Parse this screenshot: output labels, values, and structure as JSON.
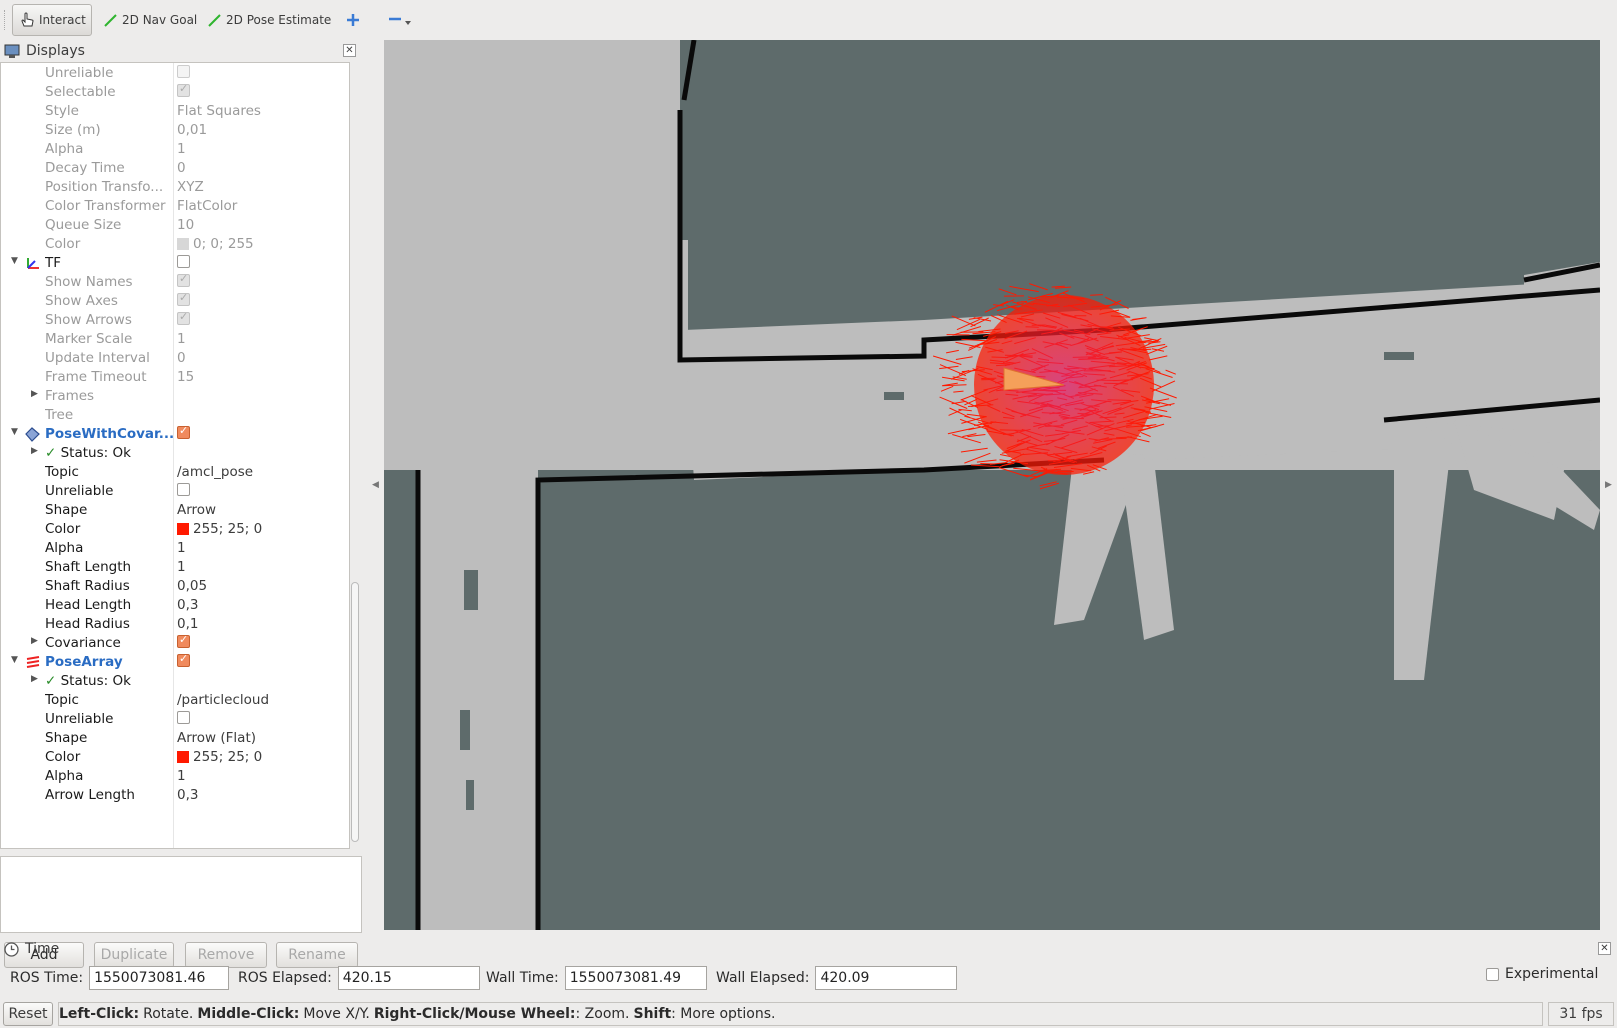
{
  "toolbar": {
    "interact_label": "Interact",
    "nav_goal_label": "2D Nav Goal",
    "pose_estimate_label": "2D Pose Estimate"
  },
  "displays": {
    "title": "Displays",
    "rows": [
      {
        "key": "Unreliable",
        "value": "",
        "check": "grey-off"
      },
      {
        "key": "Selectable",
        "value": "",
        "check": "grey-on"
      },
      {
        "key": "Style",
        "value": "Flat Squares"
      },
      {
        "key": "Size (m)",
        "value": "0,01"
      },
      {
        "key": "Alpha",
        "value": "1"
      },
      {
        "key": "Decay Time",
        "value": "0"
      },
      {
        "key": "Position Transfo...",
        "value": "XYZ"
      },
      {
        "key": "Color Transformer",
        "value": "FlatColor"
      },
      {
        "key": "Queue Size",
        "value": "10"
      },
      {
        "key": "Color",
        "value": "0; 0; 255"
      },
      {
        "key": "TF",
        "value": ""
      },
      {
        "key": "Show Names",
        "value": ""
      },
      {
        "key": "Show Axes",
        "value": ""
      },
      {
        "key": "Show Arrows",
        "value": ""
      },
      {
        "key": "Marker Scale",
        "value": "1"
      },
      {
        "key": "Update Interval",
        "value": "0"
      },
      {
        "key": "Frame Timeout",
        "value": "15"
      },
      {
        "key": "Frames",
        "value": ""
      },
      {
        "key": "Tree",
        "value": ""
      },
      {
        "key": "PoseWithCovar...",
        "value": ""
      },
      {
        "key": "Status: Ok",
        "value": ""
      },
      {
        "key": "Topic",
        "value": "/amcl_pose"
      },
      {
        "key": "Unreliable",
        "value": ""
      },
      {
        "key": "Shape",
        "value": "Arrow"
      },
      {
        "key": "Color",
        "value": "255; 25; 0"
      },
      {
        "key": "Alpha",
        "value": "1"
      },
      {
        "key": "Shaft Length",
        "value": "1"
      },
      {
        "key": "Shaft Radius",
        "value": "0,05"
      },
      {
        "key": "Head Length",
        "value": "0,3"
      },
      {
        "key": "Head Radius",
        "value": "0,1"
      },
      {
        "key": "Covariance",
        "value": ""
      },
      {
        "key": "PoseArray",
        "value": ""
      },
      {
        "key": "Status: Ok",
        "value": ""
      },
      {
        "key": "Topic",
        "value": "/particlecloud"
      },
      {
        "key": "Unreliable",
        "value": ""
      },
      {
        "key": "Shape",
        "value": "Arrow (Flat)"
      },
      {
        "key": "Color",
        "value": "255; 25; 0"
      },
      {
        "key": "Alpha",
        "value": "1"
      },
      {
        "key": "Arrow Length",
        "value": "0,3"
      }
    ],
    "buttons": {
      "add": "Add",
      "duplicate": "Duplicate",
      "remove": "Remove",
      "rename": "Rename"
    }
  },
  "colors": {
    "particle": "#ff1900",
    "map_free": "#bdbdbd",
    "map_unknown": "#5e6b6b",
    "map_wall": "#0a0a0a",
    "accent_check": "#f08a5d"
  },
  "time": {
    "title": "Time",
    "ros_time_label": "ROS Time:",
    "ros_time": "1550073081.46",
    "ros_elapsed_label": "ROS Elapsed:",
    "ros_elapsed": "420.15",
    "wall_time_label": "Wall Time:",
    "wall_time": "1550073081.49",
    "wall_elapsed_label": "Wall Elapsed:",
    "wall_elapsed": "420.09",
    "experimental_label": "Experimental"
  },
  "status": {
    "reset_label": "Reset",
    "left_click": "Left-Click:",
    "left_click_desc": "Rotate.",
    "middle_click": "Middle-Click:",
    "middle_click_desc": "Move X/Y.",
    "right_click": "Right-Click/Mouse Wheel:",
    "right_click_desc": ": Zoom.",
    "shift": "Shift",
    "shift_desc": ": More options.",
    "fps": "31 fps"
  }
}
